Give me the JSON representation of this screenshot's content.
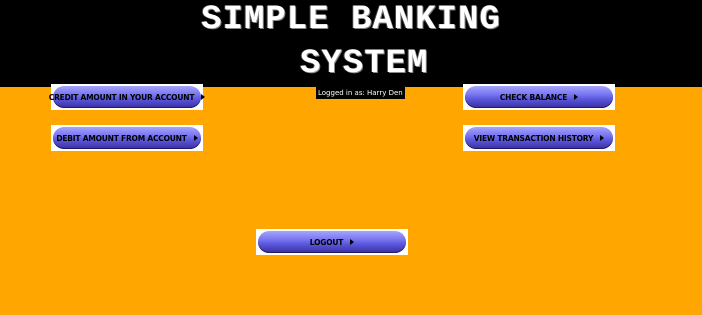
{
  "header": {
    "title_line1": "SIMPLE BANKING",
    "title_line2": "SYSTEM"
  },
  "session": {
    "logged_in_text": "Logged in as: Harry Den"
  },
  "actions": {
    "credit_label": "Credit amount in your account",
    "debit_label": "Debit amount from account",
    "balance_label": "Check Balance",
    "history_label": "View Transaction History",
    "logout_label": "Logout"
  },
  "colors": {
    "background": "#ffa600",
    "header": "#000000",
    "button": "#5a57dd"
  }
}
